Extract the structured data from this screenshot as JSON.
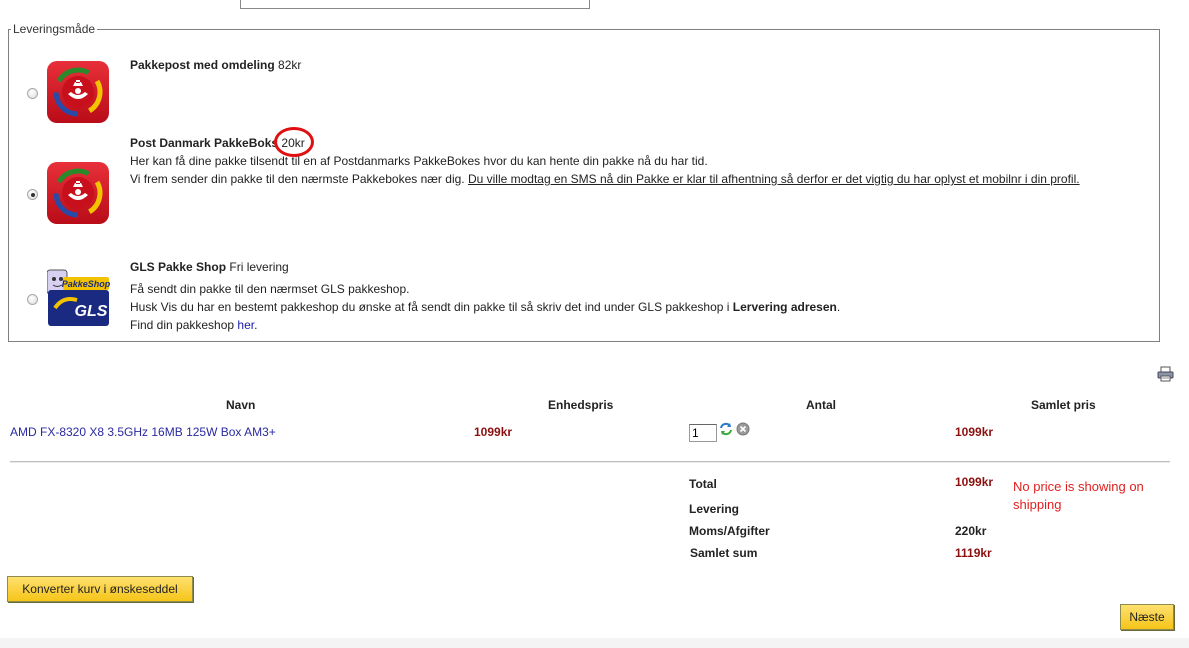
{
  "shipping": {
    "legend": "Leveringsmåde",
    "options": [
      {
        "name": "Pakkepost med omdeling",
        "price": "82kr",
        "selected": false,
        "icon": "post-danmark-icon"
      },
      {
        "name": "Post Danmark PakkeBoks",
        "price": "20kr",
        "selected": true,
        "icon": "post-danmark-icon",
        "desc1": "Her kan få dine pakke tilsendt til en af Postdanmarks PakkeBokes hvor du kan hente din pakke nå du har tid.",
        "desc2_plain": "Vi frem sender din pakke til den nærmste Pakkebokes nær dig. ",
        "desc2_underlined": "Du ville modtag en SMS nå din Pakke er klar til afhentning så derfor er det vigtig du har oplyst et mobilnr i din profil."
      },
      {
        "name": "GLS Pakke Shop",
        "price": "Fri levering",
        "selected": false,
        "icon": "gls-pakkeshop-icon",
        "logo_text_top": "PakkeShop",
        "logo_text_main": "GLS",
        "desc1": "Få sendt din pakke til den nærmset GLS pakkeshop.",
        "desc2_a": "Husk Vis du har en bestemt pakkeshop du ønske at få sendt din pakke til så skriv det ind under GLS pakkeshop i ",
        "desc2_b": "Lervering adresen",
        "desc2_c": ".",
        "desc3_a": "Find din pakkeshop ",
        "desc3_link": "her",
        "desc3_c": "."
      }
    ]
  },
  "cart": {
    "headers": {
      "name": "Navn",
      "unit_price": "Enhedspris",
      "qty": "Antal",
      "total": "Samlet pris"
    },
    "items": [
      {
        "name": "AMD FX-8320 X8 3.5GHz 16MB 125W Box AM3+",
        "unit_price": "1099kr",
        "qty": "1",
        "total": "1099kr"
      }
    ],
    "summary": {
      "total_label": "Total",
      "total_value": "1099kr",
      "delivery_label": "Levering",
      "vat_label": "Moms/Afgifter",
      "vat_value": "220kr",
      "grand_label": "Samlet sum",
      "grand_value": "1119kr"
    },
    "annotation": "No price is showing on shipping"
  },
  "buttons": {
    "wishlist": "Konverter kurv i ønskeseddel",
    "next": "Næste"
  },
  "colors": {
    "price": "#8b1010",
    "annotation": "#e02020",
    "button": "#f5c518",
    "post_red": "#d01020"
  }
}
